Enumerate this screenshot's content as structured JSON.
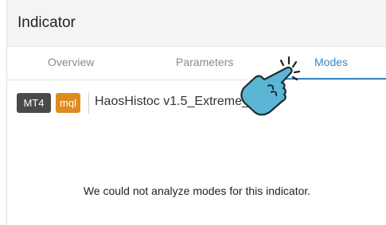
{
  "header": {
    "title": "Indicator"
  },
  "tabs": [
    {
      "label": "Overview"
    },
    {
      "label": "Parameters"
    },
    {
      "label": "Modes",
      "active": true
    }
  ],
  "badges": {
    "platform": "MT4",
    "language": "mql"
  },
  "indicator": {
    "name": "HaosHistoc v1.5_Extreme_"
  },
  "message": "We could not analyze modes for this indicator.",
  "colors": {
    "accent": "#3a86c4",
    "mt4_badge": "#4a4a4a",
    "mql_badge": "#e08b1e",
    "pointer_hand": "#5bb6d6"
  },
  "overlay": {
    "icon": "pointing-hand-icon"
  }
}
